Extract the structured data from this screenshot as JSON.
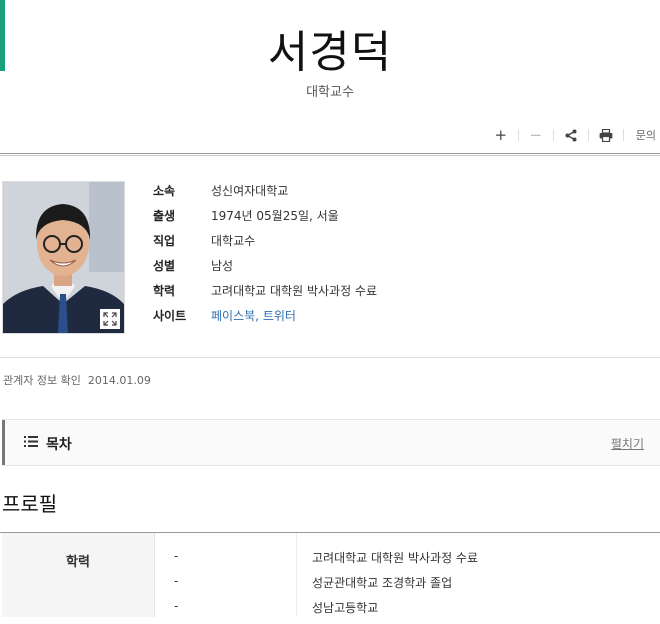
{
  "header": {
    "title": "서경덕",
    "subtitle": "대학교수"
  },
  "toolbar": {
    "zoom_in": "+",
    "zoom_out": "−",
    "inquiry": "문의"
  },
  "profile": {
    "rows": [
      {
        "label": "소속",
        "value": "성신여자대학교"
      },
      {
        "label": "출생",
        "value": "1974년 05월25일, 서울"
      },
      {
        "label": "직업",
        "value": "대학교수"
      },
      {
        "label": "성별",
        "value": "남성"
      },
      {
        "label": "학력",
        "value": "고려대학교 대학원 박사과정 수료"
      }
    ],
    "site_label": "사이트",
    "site_links": [
      "페이스북",
      "트위터"
    ],
    "site_separator": ", "
  },
  "verified": {
    "label": "관계자 정보 확인",
    "date": "2014.01.09"
  },
  "toc": {
    "title": "목차",
    "expand_label": "펼치기"
  },
  "section": {
    "title": "프로필"
  },
  "education": {
    "header": "학력",
    "rows": [
      {
        "period": "-",
        "value": "고려대학교 대학원 박사과정 수료"
      },
      {
        "period": "-",
        "value": "성균관대학교 조경학과 졸업"
      },
      {
        "period": "-",
        "value": "성남고등학교"
      }
    ]
  },
  "colors": {
    "accent": "#1ba07d",
    "link": "#2c6fb1"
  }
}
